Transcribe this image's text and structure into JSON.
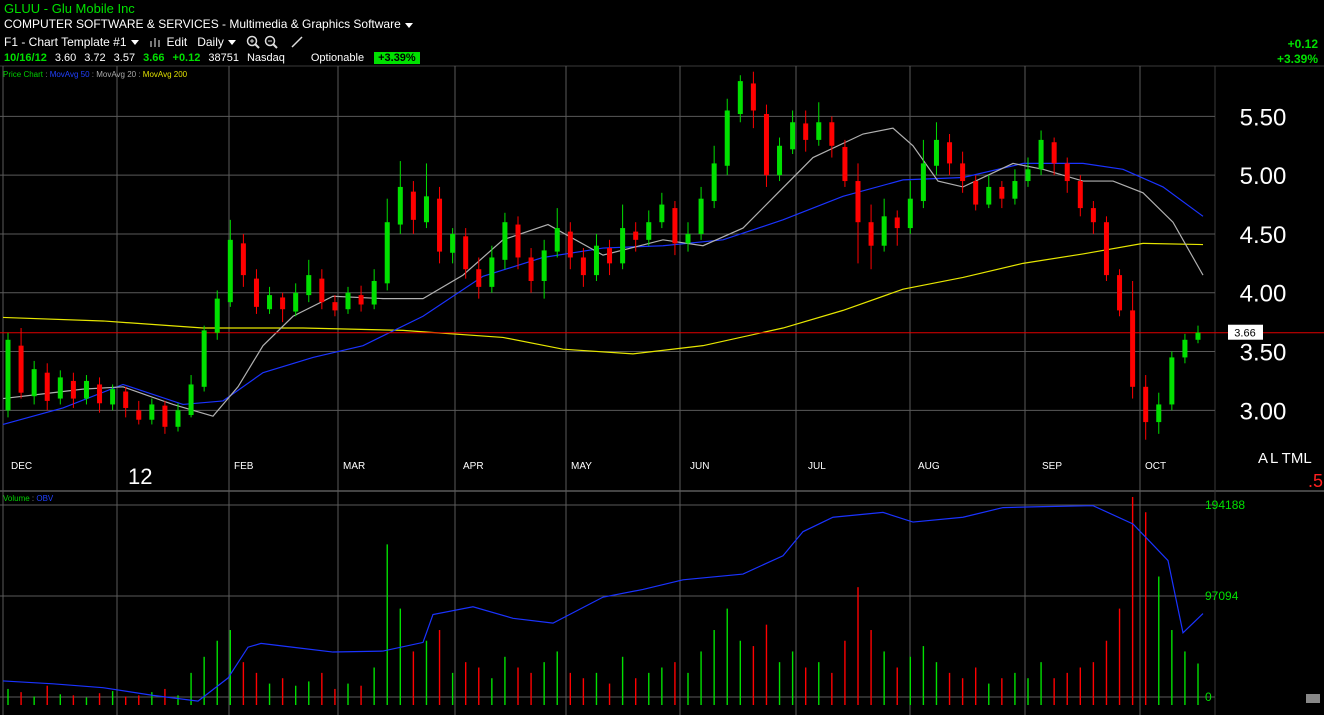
{
  "header": {
    "symbol": "GLUU",
    "separator": "-",
    "company": "Glu Mobile Inc",
    "industry": "COMPUTER SOFTWARE & SERVICES - Multimedia & Graphics Software",
    "template": "F1 - Chart Template #1",
    "edit_label": "Edit",
    "period": "Daily"
  },
  "quote": {
    "date": "10/16/12",
    "open": "3.60",
    "high": "3.72",
    "low": "3.57",
    "close": "3.66",
    "change": "+0.12",
    "volume": "38751",
    "exchange": "Nasdaq",
    "optionable": "Optionable",
    "pct_badge": "+3.39%"
  },
  "change_box": {
    "change": "+0.12",
    "pct": "+3.39%"
  },
  "indicators": [
    {
      "text": "Price Chart",
      "color": "#00d000"
    },
    {
      "text": " : ",
      "color": "#888888"
    },
    {
      "text": "MovAvg 50",
      "color": "#2040ff"
    },
    {
      "text": " : ",
      "color": "#888888"
    },
    {
      "text": "MovAvg 20",
      "color": "#aaaaaa"
    },
    {
      "text": " : ",
      "color": "#888888"
    },
    {
      "text": "MovAvg 200",
      "color": "#e0e000"
    }
  ],
  "vol_indicators": [
    {
      "text": "Volume",
      "color": "#00d000"
    },
    {
      "text": " : ",
      "color": "#888888"
    },
    {
      "text": "OBV",
      "color": "#2040ff"
    }
  ],
  "price_axis": {
    "ticks": [
      "5.50",
      "5.00",
      "4.50",
      "4.00",
      "3.50",
      "3.00"
    ],
    "last_label": "3.66"
  },
  "volume_axis": {
    "ticks": [
      "194188",
      "97094",
      "0"
    ]
  },
  "months": [
    "DEC",
    "FEB",
    "MAR",
    "APR",
    "MAY",
    "JUN",
    "JUL",
    "AUG",
    "SEP",
    "OCT"
  ],
  "year_label": "12",
  "corner": {
    "a": "A",
    "rest": "L TML",
    "red": ".5"
  },
  "colors": {
    "up": "#00e000",
    "down": "#ff0000",
    "ma50": "#1a33ff",
    "ma20": "#b0b0b0",
    "ma200": "#e6e600",
    "grid": "#5a5a5a"
  },
  "chart_data": {
    "type": "candlestick",
    "ylim": [
      2.62,
      5.92
    ],
    "volume_ylim": [
      0,
      194188
    ],
    "obv_ylim": [
      -20000,
      196000
    ],
    "ma20": [
      [
        0,
        3.1
      ],
      [
        40,
        3.14
      ],
      [
        80,
        3.18
      ],
      [
        120,
        3.2
      ],
      [
        170,
        3.05
      ],
      [
        210,
        2.95
      ],
      [
        235,
        3.2
      ],
      [
        260,
        3.55
      ],
      [
        290,
        3.8
      ],
      [
        330,
        3.97
      ],
      [
        380,
        3.95
      ],
      [
        420,
        3.95
      ],
      [
        460,
        4.15
      ],
      [
        500,
        4.45
      ],
      [
        545,
        4.58
      ],
      [
        600,
        4.32
      ],
      [
        660,
        4.45
      ],
      [
        700,
        4.4
      ],
      [
        740,
        4.55
      ],
      [
        775,
        4.85
      ],
      [
        810,
        5.15
      ],
      [
        860,
        5.35
      ],
      [
        890,
        5.4
      ],
      [
        910,
        5.25
      ],
      [
        935,
        4.95
      ],
      [
        960,
        4.9
      ],
      [
        985,
        5.0
      ],
      [
        1010,
        5.1
      ],
      [
        1040,
        5.05
      ],
      [
        1080,
        4.95
      ],
      [
        1110,
        4.95
      ],
      [
        1140,
        4.85
      ],
      [
        1170,
        4.6
      ],
      [
        1200,
        4.15
      ]
    ],
    "ma50": [
      [
        0,
        2.88
      ],
      [
        60,
        3.02
      ],
      [
        120,
        3.22
      ],
      [
        180,
        3.05
      ],
      [
        220,
        3.08
      ],
      [
        260,
        3.32
      ],
      [
        310,
        3.45
      ],
      [
        360,
        3.55
      ],
      [
        420,
        3.8
      ],
      [
        480,
        4.14
      ],
      [
        540,
        4.3
      ],
      [
        600,
        4.38
      ],
      [
        660,
        4.4
      ],
      [
        720,
        4.45
      ],
      [
        780,
        4.62
      ],
      [
        840,
        4.82
      ],
      [
        900,
        4.96
      ],
      [
        960,
        4.98
      ],
      [
        1020,
        5.1
      ],
      [
        1080,
        5.1
      ],
      [
        1120,
        5.05
      ],
      [
        1160,
        4.9
      ],
      [
        1200,
        4.65
      ]
    ],
    "ma200": [
      [
        0,
        3.79
      ],
      [
        100,
        3.76
      ],
      [
        200,
        3.7
      ],
      [
        300,
        3.7
      ],
      [
        400,
        3.68
      ],
      [
        500,
        3.62
      ],
      [
        560,
        3.52
      ],
      [
        630,
        3.48
      ],
      [
        700,
        3.55
      ],
      [
        780,
        3.7
      ],
      [
        840,
        3.85
      ],
      [
        900,
        4.03
      ],
      [
        960,
        4.13
      ],
      [
        1020,
        4.25
      ],
      [
        1080,
        4.33
      ],
      [
        1140,
        4.42
      ],
      [
        1200,
        4.41
      ]
    ],
    "obv": [
      [
        0,
        5000
      ],
      [
        50,
        2000
      ],
      [
        100,
        -2000
      ],
      [
        150,
        -10000
      ],
      [
        195,
        -16000
      ],
      [
        225,
        8000
      ],
      [
        245,
        40000
      ],
      [
        258,
        44000
      ],
      [
        290,
        40000
      ],
      [
        330,
        35000
      ],
      [
        380,
        36000
      ],
      [
        420,
        45000
      ],
      [
        430,
        74000
      ],
      [
        470,
        82000
      ],
      [
        510,
        70000
      ],
      [
        550,
        65000
      ],
      [
        600,
        92000
      ],
      [
        640,
        100000
      ],
      [
        680,
        110000
      ],
      [
        740,
        116000
      ],
      [
        780,
        135000
      ],
      [
        800,
        160000
      ],
      [
        830,
        175000
      ],
      [
        880,
        180000
      ],
      [
        910,
        170000
      ],
      [
        960,
        175000
      ],
      [
        1000,
        185000
      ],
      [
        1040,
        186000
      ],
      [
        1090,
        187000
      ],
      [
        1130,
        168000
      ],
      [
        1165,
        130000
      ],
      [
        1180,
        55000
      ],
      [
        1200,
        75000
      ]
    ],
    "candles": [
      [
        3.0,
        3.6,
        3.66,
        2.94
      ],
      [
        3.55,
        3.15,
        3.7,
        3.1
      ],
      [
        3.12,
        3.35,
        3.42,
        3.05
      ],
      [
        3.32,
        3.08,
        3.4,
        3.0
      ],
      [
        3.1,
        3.28,
        3.34,
        3.05
      ],
      [
        3.25,
        3.1,
        3.32,
        3.02
      ],
      [
        3.1,
        3.25,
        3.3,
        3.05
      ],
      [
        3.22,
        3.06,
        3.28,
        2.98
      ],
      [
        3.05,
        3.18,
        3.22,
        3.0
      ],
      [
        3.16,
        3.02,
        3.2,
        2.94
      ],
      [
        3.0,
        2.92,
        3.08,
        2.88
      ],
      [
        2.92,
        3.05,
        3.1,
        2.88
      ],
      [
        3.04,
        2.86,
        3.08,
        2.8
      ],
      [
        2.86,
        3.0,
        3.06,
        2.82
      ],
      [
        2.96,
        3.22,
        3.3,
        2.94
      ],
      [
        3.2,
        3.68,
        3.72,
        3.16
      ],
      [
        3.66,
        3.95,
        4.02,
        3.6
      ],
      [
        3.92,
        4.45,
        4.62,
        3.88
      ],
      [
        4.42,
        4.15,
        4.5,
        4.05
      ],
      [
        4.12,
        3.88,
        4.2,
        3.82
      ],
      [
        3.86,
        3.98,
        4.05,
        3.82
      ],
      [
        3.96,
        3.86,
        4.0,
        3.75
      ],
      [
        3.84,
        4.0,
        4.08,
        3.8
      ],
      [
        3.98,
        4.15,
        4.28,
        3.92
      ],
      [
        4.12,
        3.92,
        4.2,
        3.86
      ],
      [
        3.92,
        3.85,
        3.98,
        3.8
      ],
      [
        3.86,
        4.0,
        4.05,
        3.82
      ],
      [
        3.98,
        3.9,
        4.06,
        3.84
      ],
      [
        3.9,
        4.1,
        4.2,
        3.86
      ],
      [
        4.08,
        4.6,
        4.8,
        4.02
      ],
      [
        4.58,
        4.9,
        5.12,
        4.5
      ],
      [
        4.86,
        4.62,
        4.95,
        4.5
      ],
      [
        4.6,
        4.82,
        5.1,
        4.55
      ],
      [
        4.8,
        4.35,
        4.9,
        4.25
      ],
      [
        4.34,
        4.5,
        4.55,
        4.25
      ],
      [
        4.48,
        4.2,
        4.55,
        4.12
      ],
      [
        4.2,
        4.05,
        4.3,
        3.95
      ],
      [
        4.05,
        4.3,
        4.4,
        4.0
      ],
      [
        4.28,
        4.6,
        4.68,
        4.2
      ],
      [
        4.58,
        4.3,
        4.65,
        4.2
      ],
      [
        4.3,
        4.1,
        4.38,
        4.0
      ],
      [
        4.1,
        4.36,
        4.45,
        3.95
      ],
      [
        4.35,
        4.55,
        4.72,
        4.3
      ],
      [
        4.52,
        4.3,
        4.6,
        4.2
      ],
      [
        4.3,
        4.15,
        4.38,
        4.05
      ],
      [
        4.15,
        4.4,
        4.5,
        4.1
      ],
      [
        4.38,
        4.25,
        4.45,
        4.15
      ],
      [
        4.25,
        4.55,
        4.75,
        4.2
      ],
      [
        4.52,
        4.45,
        4.6,
        4.35
      ],
      [
        4.45,
        4.6,
        4.7,
        4.4
      ],
      [
        4.6,
        4.75,
        4.85,
        4.55
      ],
      [
        4.72,
        4.42,
        4.78,
        4.32
      ],
      [
        4.42,
        4.5,
        4.6,
        4.35
      ],
      [
        4.5,
        4.8,
        4.9,
        4.45
      ],
      [
        4.78,
        5.1,
        5.25,
        4.72
      ],
      [
        5.08,
        5.55,
        5.65,
        5.0
      ],
      [
        5.52,
        5.8,
        5.85,
        5.45
      ],
      [
        5.78,
        5.55,
        5.88,
        5.4
      ],
      [
        5.52,
        5.0,
        5.6,
        4.9
      ],
      [
        5.0,
        5.25,
        5.32,
        4.95
      ],
      [
        5.22,
        5.45,
        5.55,
        5.18
      ],
      [
        5.44,
        5.3,
        5.55,
        5.2
      ],
      [
        5.3,
        5.45,
        5.62,
        5.25
      ],
      [
        5.45,
        5.25,
        5.5,
        5.15
      ],
      [
        5.24,
        4.95,
        5.3,
        4.9
      ],
      [
        4.95,
        4.6,
        5.1,
        4.25
      ],
      [
        4.6,
        4.4,
        4.75,
        4.2
      ],
      [
        4.4,
        4.65,
        4.8,
        4.35
      ],
      [
        4.64,
        4.55,
        4.7,
        4.4
      ],
      [
        4.55,
        4.8,
        4.95,
        4.5
      ],
      [
        4.78,
        5.1,
        5.3,
        4.72
      ],
      [
        5.08,
        5.3,
        5.45,
        5.0
      ],
      [
        5.28,
        5.1,
        5.35,
        5.0
      ],
      [
        5.1,
        4.95,
        5.2,
        4.85
      ],
      [
        4.95,
        4.75,
        5.0,
        4.7
      ],
      [
        4.75,
        4.9,
        5.0,
        4.72
      ],
      [
        4.9,
        4.8,
        4.95,
        4.72
      ],
      [
        4.8,
        4.95,
        5.05,
        4.75
      ],
      [
        4.95,
        5.05,
        5.15,
        4.9
      ],
      [
        5.05,
        5.3,
        5.38,
        5.0
      ],
      [
        5.28,
        5.1,
        5.32,
        5.0
      ],
      [
        5.1,
        4.95,
        5.15,
        4.85
      ],
      [
        4.95,
        4.72,
        5.0,
        4.65
      ],
      [
        4.72,
        4.6,
        4.78,
        4.5
      ],
      [
        4.6,
        4.15,
        4.65,
        4.1
      ],
      [
        4.15,
        3.85,
        4.2,
        3.8
      ],
      [
        3.85,
        3.2,
        4.1,
        3.1
      ],
      [
        3.2,
        2.9,
        3.3,
        2.75
      ],
      [
        2.9,
        3.05,
        3.15,
        2.8
      ],
      [
        3.05,
        3.45,
        3.5,
        3.0
      ],
      [
        3.45,
        3.6,
        3.65,
        3.4
      ],
      [
        3.6,
        3.66,
        3.72,
        3.57
      ]
    ],
    "volumes": [
      [
        15000,
        "g"
      ],
      [
        12000,
        "r"
      ],
      [
        8000,
        "g"
      ],
      [
        18000,
        "r"
      ],
      [
        10000,
        "g"
      ],
      [
        9000,
        "r"
      ],
      [
        7000,
        "g"
      ],
      [
        11000,
        "r"
      ],
      [
        13000,
        "g"
      ],
      [
        8000,
        "r"
      ],
      [
        9000,
        "r"
      ],
      [
        12000,
        "g"
      ],
      [
        15000,
        "r"
      ],
      [
        9000,
        "g"
      ],
      [
        30000,
        "g"
      ],
      [
        45000,
        "g"
      ],
      [
        60000,
        "g"
      ],
      [
        70000,
        "g"
      ],
      [
        40000,
        "r"
      ],
      [
        30000,
        "r"
      ],
      [
        20000,
        "g"
      ],
      [
        25000,
        "r"
      ],
      [
        18000,
        "g"
      ],
      [
        22000,
        "g"
      ],
      [
        30000,
        "r"
      ],
      [
        15000,
        "r"
      ],
      [
        20000,
        "g"
      ],
      [
        18000,
        "r"
      ],
      [
        35000,
        "g"
      ],
      [
        150000,
        "g"
      ],
      [
        90000,
        "g"
      ],
      [
        50000,
        "r"
      ],
      [
        60000,
        "g"
      ],
      [
        70000,
        "r"
      ],
      [
        30000,
        "g"
      ],
      [
        40000,
        "r"
      ],
      [
        35000,
        "r"
      ],
      [
        25000,
        "g"
      ],
      [
        45000,
        "g"
      ],
      [
        35000,
        "r"
      ],
      [
        30000,
        "r"
      ],
      [
        40000,
        "g"
      ],
      [
        50000,
        "g"
      ],
      [
        30000,
        "r"
      ],
      [
        25000,
        "r"
      ],
      [
        30000,
        "g"
      ],
      [
        20000,
        "r"
      ],
      [
        45000,
        "g"
      ],
      [
        25000,
        "r"
      ],
      [
        30000,
        "g"
      ],
      [
        35000,
        "g"
      ],
      [
        40000,
        "r"
      ],
      [
        30000,
        "g"
      ],
      [
        50000,
        "g"
      ],
      [
        70000,
        "g"
      ],
      [
        90000,
        "g"
      ],
      [
        60000,
        "g"
      ],
      [
        55000,
        "r"
      ],
      [
        75000,
        "r"
      ],
      [
        40000,
        "g"
      ],
      [
        50000,
        "g"
      ],
      [
        35000,
        "r"
      ],
      [
        40000,
        "g"
      ],
      [
        30000,
        "r"
      ],
      [
        60000,
        "r"
      ],
      [
        110000,
        "r"
      ],
      [
        70000,
        "r"
      ],
      [
        50000,
        "g"
      ],
      [
        35000,
        "r"
      ],
      [
        45000,
        "g"
      ],
      [
        55000,
        "g"
      ],
      [
        40000,
        "g"
      ],
      [
        30000,
        "r"
      ],
      [
        25000,
        "r"
      ],
      [
        35000,
        "r"
      ],
      [
        20000,
        "g"
      ],
      [
        25000,
        "r"
      ],
      [
        30000,
        "g"
      ],
      [
        25000,
        "g"
      ],
      [
        40000,
        "g"
      ],
      [
        25000,
        "r"
      ],
      [
        30000,
        "r"
      ],
      [
        35000,
        "r"
      ],
      [
        40000,
        "r"
      ],
      [
        60000,
        "r"
      ],
      [
        90000,
        "r"
      ],
      [
        194188,
        "r"
      ],
      [
        180000,
        "r"
      ],
      [
        120000,
        "g"
      ],
      [
        70000,
        "g"
      ],
      [
        50000,
        "g"
      ],
      [
        38751,
        "g"
      ]
    ]
  }
}
